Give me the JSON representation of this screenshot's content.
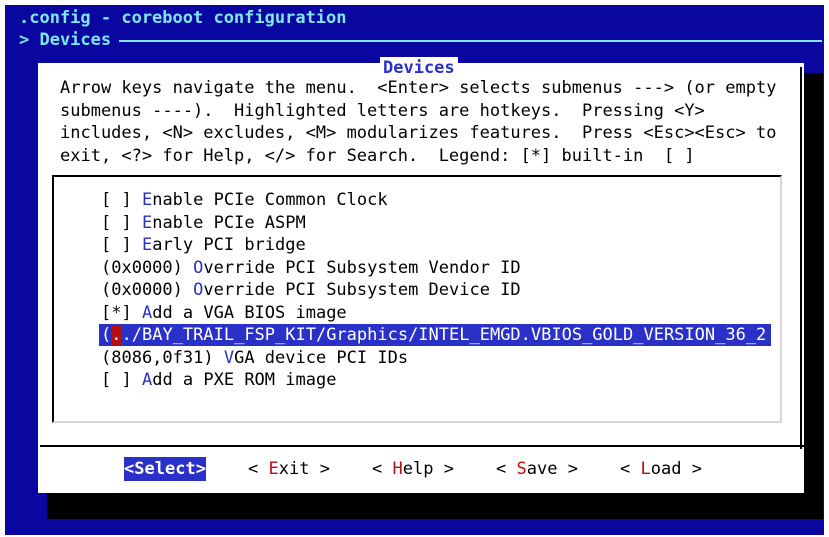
{
  "window": {
    "title": ".config - coreboot configuration",
    "breadcrumb": "> Devices"
  },
  "dialog": {
    "title": "Devices",
    "help_lines": [
      "Arrow keys navigate the menu.  <Enter> selects submenus ---> (or empty",
      "submenus ----).  Highlighted letters are hotkeys.  Pressing <Y>",
      "includes, <N> excludes, <M> modularizes features.  Press <Esc><Esc> to",
      "exit, <?> for Help, </> for Search.  Legend: [*] built-in  [ ]"
    ]
  },
  "menu": {
    "items": [
      {
        "prefix": "[ ] ",
        "hotkey": "E",
        "rest": "nable PCIe Common Clock"
      },
      {
        "prefix": "[ ] ",
        "hotkey": "E",
        "rest": "nable PCIe ASPM"
      },
      {
        "prefix": "[ ] ",
        "hotkey": "E",
        "rest": "arly PCI bridge"
      },
      {
        "prefix": "(0x0000) ",
        "hotkey": "O",
        "rest": "verride PCI Subsystem Vendor ID"
      },
      {
        "prefix": "(0x0000) ",
        "hotkey": "O",
        "rest": "verride PCI Subsystem Device ID"
      },
      {
        "prefix": "[*] ",
        "hotkey": "A",
        "rest": "dd a VGA BIOS image"
      },
      {
        "prefix": "(",
        "hotkey": ".",
        "rest": "./BAY_TRAIL_FSP_KIT/Graphics/INTEL_EMGD.VBIOS_GOLD_VERSION_36_2"
      },
      {
        "prefix": "(8086,0f31) ",
        "hotkey": "V",
        "rest": "GA device PCI IDs"
      },
      {
        "prefix": "[ ] ",
        "hotkey": "A",
        "rest": "dd a PXE ROM image"
      }
    ]
  },
  "buttons": {
    "select": {
      "lt": "<",
      "hotkey": "S",
      "rest": "elect",
      "gt": ">"
    },
    "exit": {
      "lt": "< ",
      "hotkey": "E",
      "rest": "xit",
      "gt": " >"
    },
    "help": {
      "lt": "< ",
      "hotkey": "H",
      "rest": "elp",
      "gt": " >"
    },
    "save": {
      "lt": "< ",
      "hotkey": "S",
      "rest": "ave",
      "gt": " >"
    },
    "load": {
      "lt": "< ",
      "hotkey": "L",
      "rest": "oad",
      "gt": " >"
    }
  }
}
